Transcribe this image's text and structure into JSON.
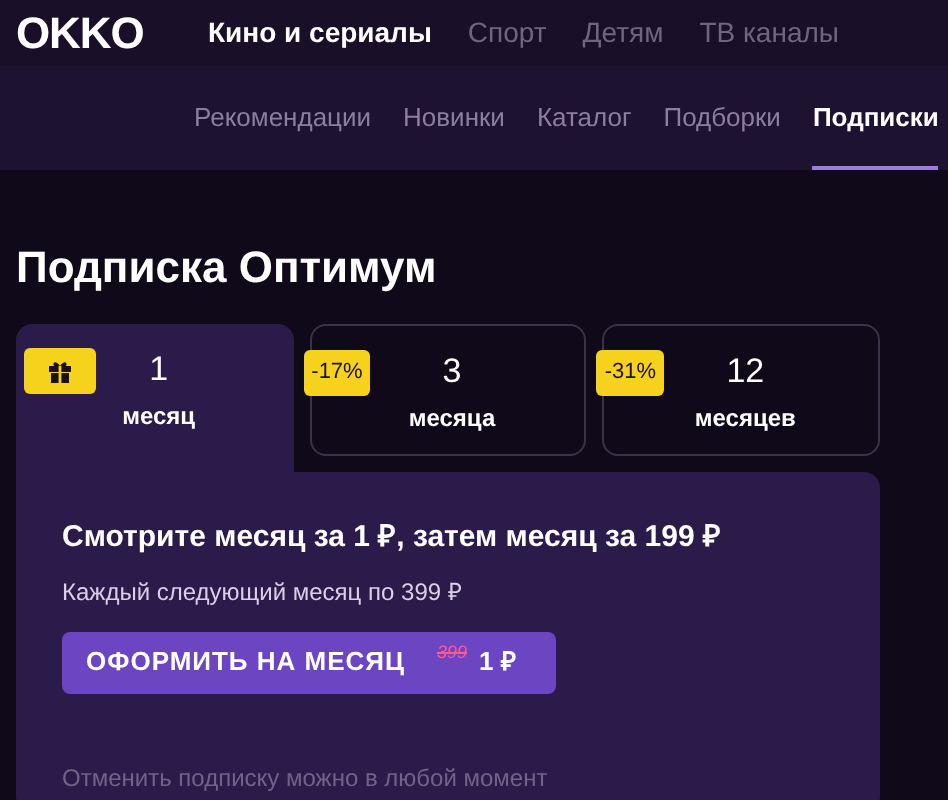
{
  "logo": "OKKO",
  "top_nav": [
    {
      "label": "Кино и сериалы",
      "selected": true
    },
    {
      "label": "Спорт",
      "selected": false
    },
    {
      "label": "Детям",
      "selected": false
    },
    {
      "label": "ТВ каналы",
      "selected": false
    }
  ],
  "sub_nav": [
    {
      "label": "Рекомендации",
      "selected": false
    },
    {
      "label": "Новинки",
      "selected": false
    },
    {
      "label": "Каталог",
      "selected": false
    },
    {
      "label": "Подборки",
      "selected": false
    },
    {
      "label": "Подписки",
      "selected": true
    }
  ],
  "title": "Подписка Оптимум",
  "periods": [
    {
      "count": "1",
      "unit": "месяц",
      "selected": true,
      "badge": {
        "kind": "gift"
      }
    },
    {
      "count": "3",
      "unit": "месяца",
      "selected": false,
      "badge": {
        "kind": "discount",
        "text": "-17%"
      }
    },
    {
      "count": "12",
      "unit": "месяцев",
      "selected": false,
      "badge": {
        "kind": "discount",
        "text": "-31%"
      }
    }
  ],
  "offer": {
    "headline": "Смотрите месяц за 1 ₽, затем месяц за 199 ₽",
    "subtext": "Каждый следующий месяц по 399 ₽",
    "button": {
      "label": "ОФОРМИТЬ НА МЕСЯЦ",
      "old_price": "399",
      "price": "1 ₽"
    },
    "note": "Отменить подписку можно в любой момент"
  }
}
